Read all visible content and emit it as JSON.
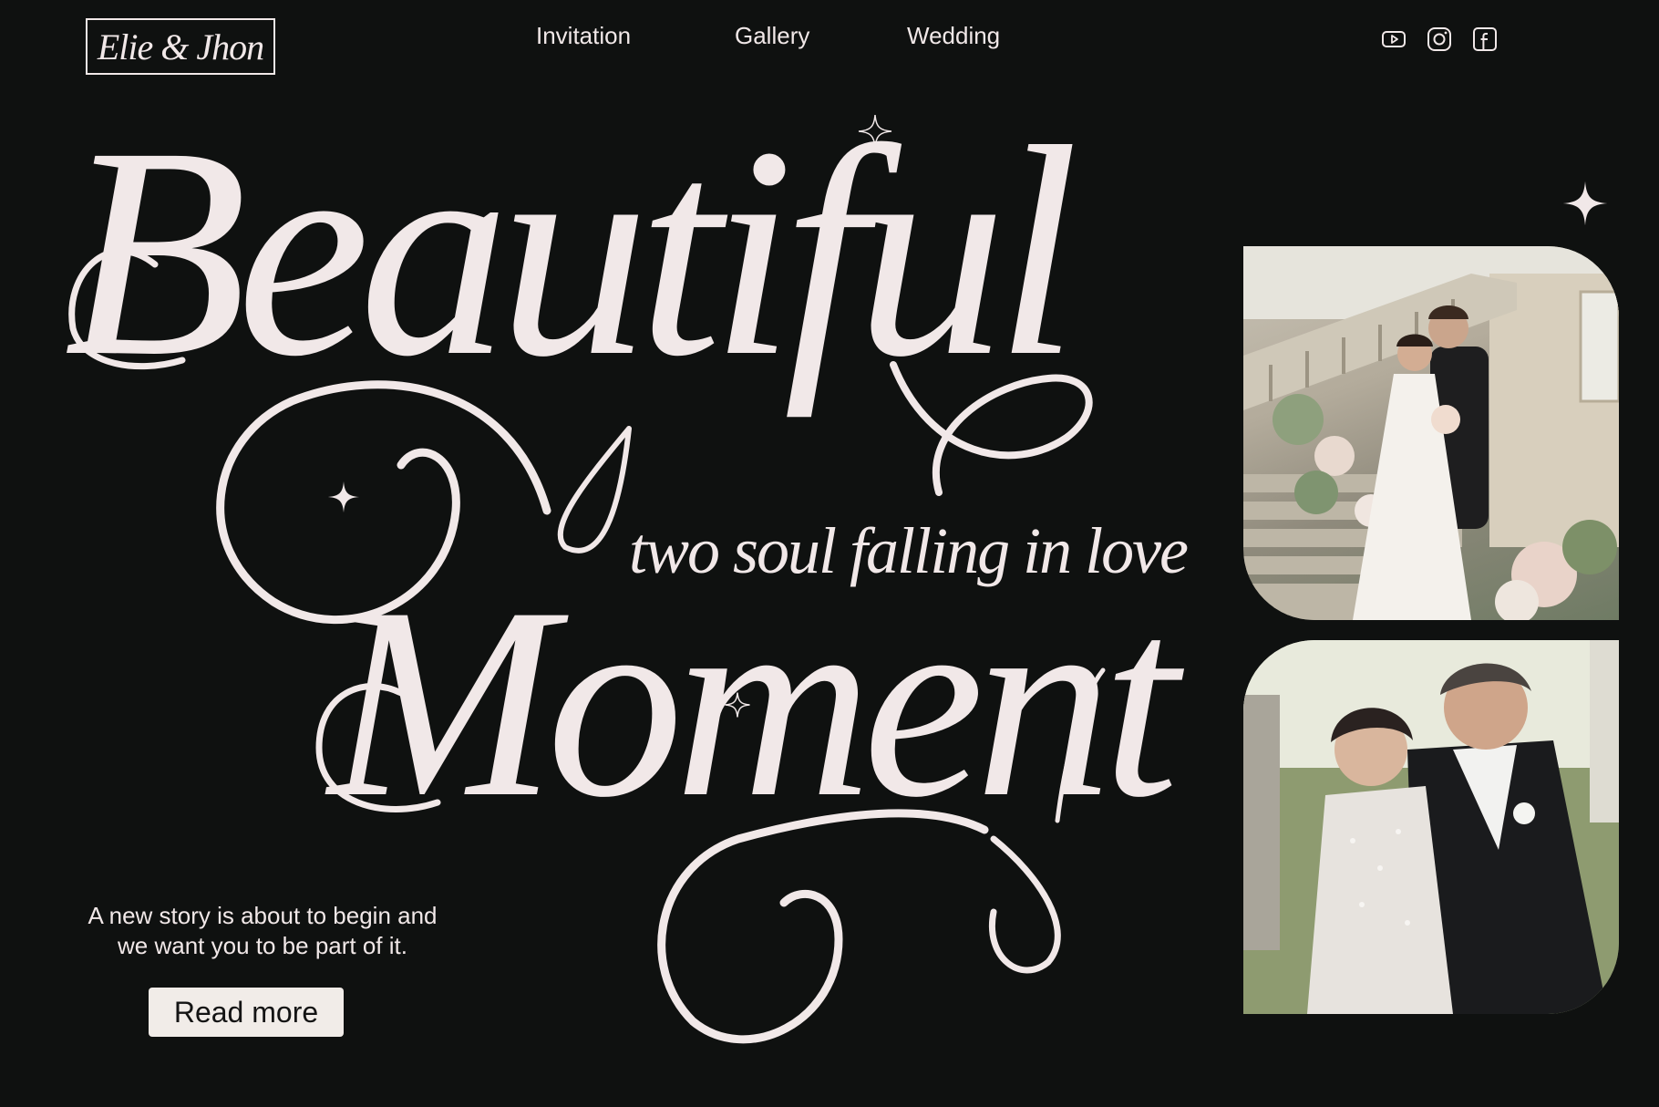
{
  "header": {
    "logo": "Elie & Jhon",
    "nav": [
      {
        "label": "Invitation"
      },
      {
        "label": "Gallery"
      },
      {
        "label": "Wedding"
      }
    ],
    "social_icons": [
      "youtube-icon",
      "instagram-icon",
      "facebook-icon"
    ]
  },
  "hero": {
    "word1": "Beautiful",
    "word2": "Moment",
    "tagline": "two soul falling in love"
  },
  "intro": {
    "line1": "A new story is about to begin and",
    "line2": "we want you to be part of it.",
    "button": "Read more"
  },
  "colors": {
    "background": "#0f1110",
    "text": "#f1e8e8",
    "button_bg": "#f1ece8",
    "button_text": "#141414"
  }
}
